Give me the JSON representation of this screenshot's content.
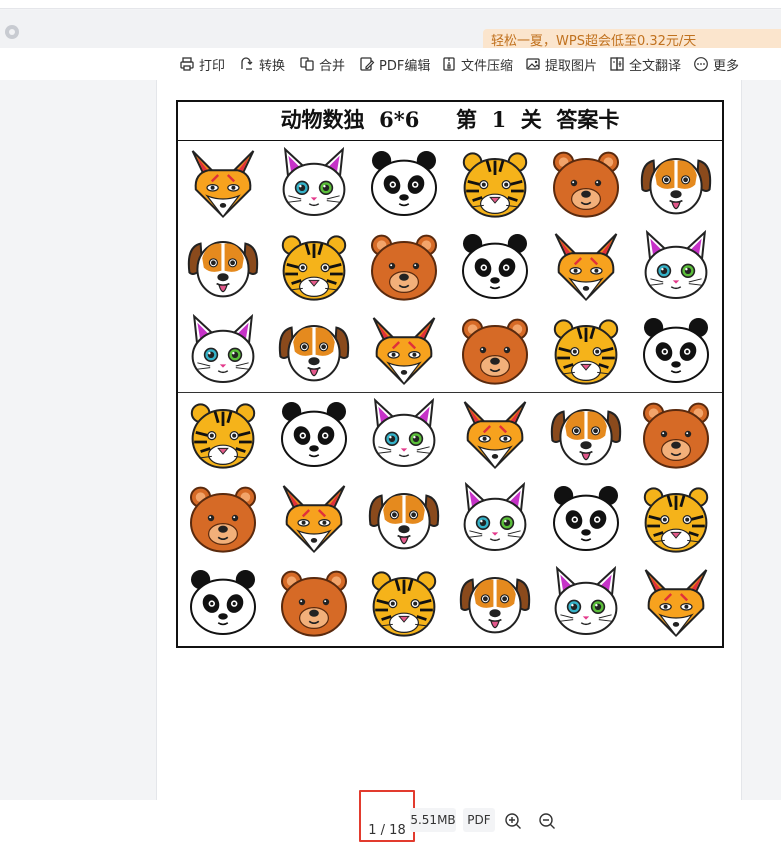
{
  "promo": {
    "text": "轻松一夏，WPS超会低至0.32元/天"
  },
  "toolbar": {
    "items": [
      {
        "label": "打印",
        "icon": "printer-icon"
      },
      {
        "label": "转换",
        "icon": "convert-icon"
      },
      {
        "label": "合并",
        "icon": "merge-icon"
      },
      {
        "label": "PDF编辑",
        "icon": "pdf-edit-icon"
      },
      {
        "label": "文件压缩",
        "icon": "compress-icon"
      },
      {
        "label": "提取图片",
        "icon": "image-extract-icon"
      },
      {
        "label": "全文翻译",
        "icon": "translate-icon"
      },
      {
        "label": "更多",
        "icon": "more-icon"
      }
    ]
  },
  "document": {
    "title": "动物数独  6*6     第  1  关  答案卡",
    "grid": [
      [
        "fox",
        "cat",
        "panda",
        "tiger",
        "bear",
        "dog"
      ],
      [
        "dog",
        "tiger",
        "bear",
        "panda",
        "fox",
        "cat"
      ],
      [
        "cat",
        "dog",
        "fox",
        "bear",
        "tiger",
        "panda"
      ],
      [
        "tiger",
        "panda",
        "cat",
        "fox",
        "dog",
        "bear"
      ],
      [
        "bear",
        "fox",
        "dog",
        "cat",
        "panda",
        "tiger"
      ],
      [
        "panda",
        "bear",
        "tiger",
        "dog",
        "cat",
        "fox"
      ]
    ]
  },
  "footer": {
    "page_indicator": "1 / 18",
    "file_size": "5.51MB",
    "file_type": "PDF"
  }
}
